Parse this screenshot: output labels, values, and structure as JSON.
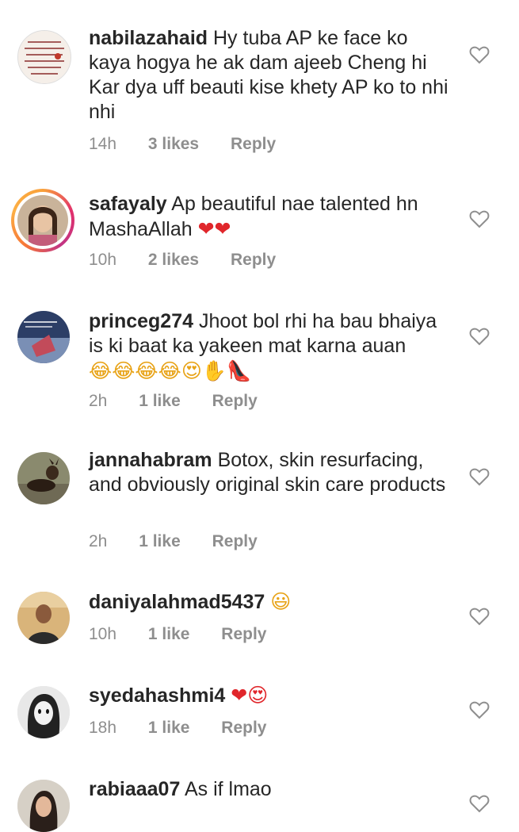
{
  "comments": [
    {
      "username": "nabilazahaid",
      "text": "Hy tuba AP ke face ko kaya hogya he ak dam ajeeb Cheng hi Kar dya uff beauti kise khety AP ko to nhi nhi",
      "time": "14h",
      "likes": "3 likes",
      "reply": "Reply"
    },
    {
      "username": "safayaly",
      "text": "Ap beautiful nae talented hn MashaAllah",
      "emoji": "❤❤",
      "time": "10h",
      "likes": "2 likes",
      "reply": "Reply"
    },
    {
      "username": "princeg274",
      "text": "Jhoot bol rhi ha bau bhaiya is ki baat ka yakeen mat karna auan",
      "emoji": "😂😂😂😂😍✋👠",
      "time": "2h",
      "likes": "1 like",
      "reply": "Reply"
    },
    {
      "username": "jannahabram",
      "text": "Botox, skin resurfacing, and obviously original skin care products",
      "time": "2h",
      "likes": "1 like",
      "reply": "Reply"
    },
    {
      "username": "daniyalahmad5437",
      "text": "",
      "emoji": "😃",
      "time": "10h",
      "likes": "1 like",
      "reply": "Reply"
    },
    {
      "username": "syedahashmi4",
      "text": "",
      "emoji": "❤😍",
      "time": "18h",
      "likes": "1 like",
      "reply": "Reply"
    },
    {
      "username": "rabiaaa07",
      "text": "As if lmao",
      "time": "",
      "likes": "",
      "reply": ""
    }
  ]
}
